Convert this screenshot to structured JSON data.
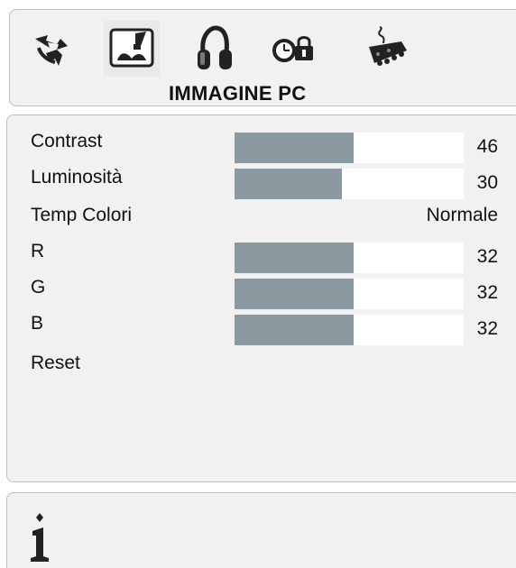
{
  "header": {
    "title": "IMMAGINE PC",
    "icons": [
      {
        "name": "arrows-icon",
        "selected": false
      },
      {
        "name": "picture-icon",
        "selected": true
      },
      {
        "name": "headphones-icon",
        "selected": false
      },
      {
        "name": "clock-lock-icon",
        "selected": false
      },
      {
        "name": "connector-icon",
        "selected": false
      }
    ]
  },
  "menu": {
    "items": [
      {
        "label": "Contrast",
        "value": "46",
        "level": 0.52
      },
      {
        "label": "Luminosità",
        "value": "30",
        "level": 0.47
      },
      {
        "label": "Temp Colori",
        "value": "Normale"
      },
      {
        "label": "R",
        "value": "32",
        "level": 0.52
      },
      {
        "label": "G",
        "value": "32",
        "level": 0.52
      },
      {
        "label": "B",
        "value": "32",
        "level": 0.52
      },
      {
        "label": "Reset"
      }
    ]
  },
  "colors": {
    "bar_fill": "#8b9aa0",
    "panel_bg": "#f1f1f1"
  },
  "info": {
    "icon": "info-icon"
  }
}
